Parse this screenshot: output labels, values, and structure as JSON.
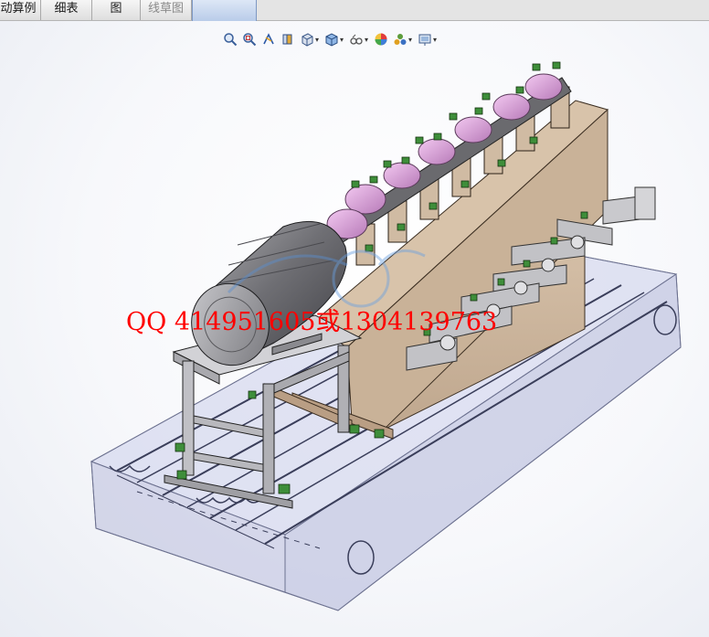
{
  "tabs": [
    {
      "label": "动算例"
    },
    {
      "label": "细表"
    },
    {
      "label": "图"
    },
    {
      "label": "线草图"
    },
    {
      "label": ""
    }
  ],
  "toolbar": {
    "icons": [
      "zoom-to-fit-icon",
      "zoom-area-icon",
      "previous-view-icon",
      "section-view-icon",
      "view-orientation-icon",
      "display-style-icon",
      "hide-show-icon",
      "edit-appearance-icon",
      "apply-scene-icon",
      "view-settings-icon"
    ]
  },
  "watermark": {
    "text": "QQ 414951605或1304139763"
  }
}
